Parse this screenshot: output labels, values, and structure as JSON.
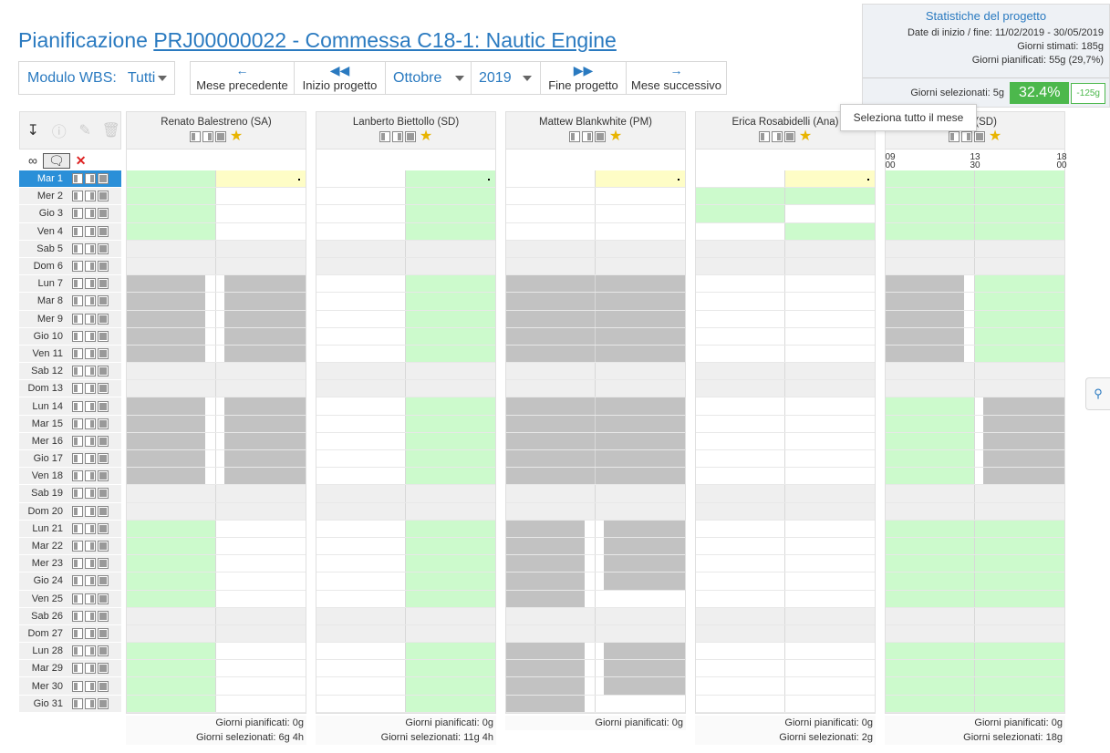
{
  "header": {
    "title_prefix": "Pianificazione ",
    "title_link": "PRJ00000022 - Commessa C18-1: Nautic Engine"
  },
  "filters": {
    "wbs_label": "Modulo WBS:",
    "wbs_value": "Tutti"
  },
  "nav": {
    "prev": "Mese precedente",
    "start": "Inizio progetto",
    "month": "Ottobre",
    "year": "2019",
    "end": "Fine progetto",
    "next": "Mese successivo"
  },
  "stats": {
    "title": "Statistiche del progetto",
    "dates": "Date di inizio / fine: 11/02/2019 - 30/05/2019",
    "estimated": "Giorni stimati: 185g",
    "planned": "Giorni pianificati: 55g (29,7%)",
    "selected": "Giorni selezionati: 5g",
    "percent": "32.4%",
    "delta": "-125g"
  },
  "tooltip": "Seleziona tutto il mese",
  "time_axis": {
    "t1": "09",
    "t1b": "00",
    "t2": "13",
    "t2b": "30",
    "t3": "18",
    "t3b": "00"
  },
  "days": [
    "Mar 1",
    "Mer 2",
    "Gio 3",
    "Ven 4",
    "Sab 5",
    "Dom 6",
    "Lun 7",
    "Mar 8",
    "Mer 9",
    "Gio 10",
    "Ven 11",
    "Sab 12",
    "Dom 13",
    "Lun 14",
    "Mar 15",
    "Mer 16",
    "Gio 17",
    "Ven 18",
    "Sab 19",
    "Dom 20",
    "Lun 21",
    "Mar 22",
    "Mer 23",
    "Gio 24",
    "Ven 25",
    "Sab 26",
    "Dom 27",
    "Lun 28",
    "Mar 29",
    "Mer 30",
    "Gio 31"
  ],
  "resources": [
    {
      "name": "Renato Balestreno (SA)",
      "planned": "Giorni pianificati: 0g",
      "selected": "Giorni selezionati: 6g 4h"
    },
    {
      "name": "Lanberto Biettollo (SD)",
      "planned": "Giorni pianificati: 0g",
      "selected": "Giorni selezionati: 11g 4h"
    },
    {
      "name": "Mattew Blankwhite (PM)",
      "planned": "Giorni pianificati: 0g",
      "selected": ""
    },
    {
      "name": "Erica Rosabidelli (Ana)",
      "planned": "Giorni pianificati: 0g",
      "selected": "Giorni selezionati: 2g"
    },
    {
      "name": "arici (SD)",
      "planned": "Giorni pianificati: 0g",
      "selected": "Giorni selezionati: 18g"
    }
  ],
  "colors": {
    "accent": "#2a7ac0",
    "planned_green": "#ccfacc",
    "today_yellow": "#fefdc6",
    "busy_gray": "#c2c2c2"
  }
}
